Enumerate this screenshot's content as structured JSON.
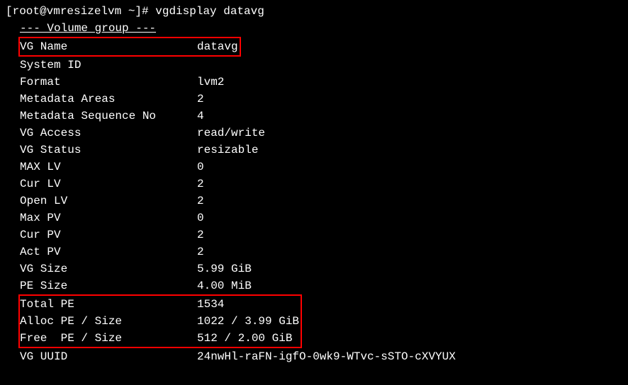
{
  "prompt": "[root@vmresizelvm ~]# vgdisplay datavg",
  "header": "--- Volume group ---",
  "rows": {
    "vg_name": {
      "label": "VG Name",
      "value": "datavg"
    },
    "system_id": {
      "label": "System ID",
      "value": ""
    },
    "format": {
      "label": "Format",
      "value": "lvm2"
    },
    "metadata_areas": {
      "label": "Metadata Areas",
      "value": "2"
    },
    "metadata_seq": {
      "label": "Metadata Sequence No",
      "value": "4"
    },
    "vg_access": {
      "label": "VG Access",
      "value": "read/write"
    },
    "vg_status": {
      "label": "VG Status",
      "value": "resizable"
    },
    "max_lv": {
      "label": "MAX LV",
      "value": "0"
    },
    "cur_lv": {
      "label": "Cur LV",
      "value": "2"
    },
    "open_lv": {
      "label": "Open LV",
      "value": "2"
    },
    "max_pv": {
      "label": "Max PV",
      "value": "0"
    },
    "cur_pv": {
      "label": "Cur PV",
      "value": "2"
    },
    "act_pv": {
      "label": "Act PV",
      "value": "2"
    },
    "vg_size": {
      "label": "VG Size",
      "value": "5.99 GiB"
    },
    "pe_size": {
      "label": "PE Size",
      "value": "4.00 MiB"
    },
    "total_pe": {
      "label": "Total PE",
      "value": "1534"
    },
    "alloc_pe": {
      "label": "Alloc PE / Size",
      "value": "1022 / 3.99 GiB"
    },
    "free_pe": {
      "label": "Free  PE / Size",
      "value": "512 / 2.00 GiB"
    },
    "vg_uuid": {
      "label": "VG UUID",
      "value": "24nwHl-raFN-igfO-0wk9-WTvc-sSTO-cXVYUX"
    }
  }
}
